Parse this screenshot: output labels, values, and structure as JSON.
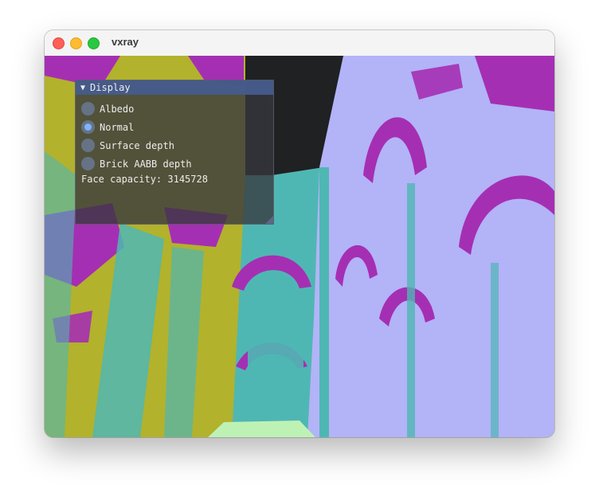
{
  "window": {
    "title": "vxray"
  },
  "panel": {
    "title": "Display",
    "options": [
      {
        "label": "Albedo",
        "checked": false
      },
      {
        "label": "Normal",
        "checked": true
      },
      {
        "label": "Surface depth",
        "checked": false
      },
      {
        "label": "Brick AABB depth",
        "checked": false
      }
    ],
    "info": "Face capacity: 3145728"
  },
  "colors": {
    "teal": "#4fb7b3",
    "lavender": "#b3b3f7",
    "magenta": "#a52fb3",
    "olive": "#b2b22d",
    "dark": "#1f2123",
    "mint": "#bef2b5",
    "panel_header": "#465c8c"
  }
}
